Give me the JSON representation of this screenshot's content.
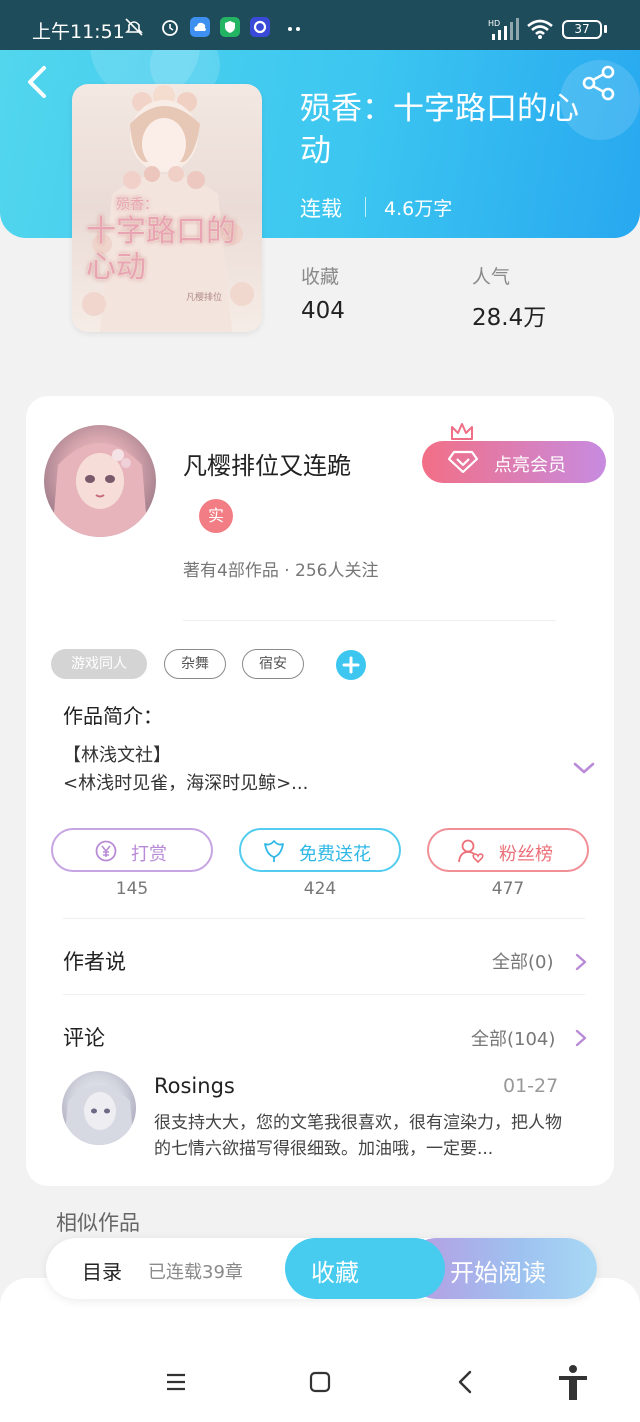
{
  "status_bar": {
    "time": "上午11:51",
    "battery": "37"
  },
  "book": {
    "title": "殒香：十字路口的心动",
    "status": "连载",
    "word_count": "4.6万字",
    "cover_text_top": "殒香：",
    "cover_text_main": "十字路口的心动",
    "cover_text_sub": "凡樱排位"
  },
  "stats": {
    "collect_label": "收藏",
    "collect_value": "404",
    "popularity_label": "人气",
    "popularity_value": "28.4万"
  },
  "author": {
    "name": "凡樱排位又连跪",
    "badge": "实",
    "meta": "著有4部作品 · 256人关注",
    "vip_label": "点亮会员"
  },
  "tags": [
    "游戏同人",
    "杂舞",
    "宿安"
  ],
  "intro": {
    "title": "作品简介：",
    "line1": "【林浅文社】",
    "line2": "<林浅时见雀，海深时见鲸>..."
  },
  "actions": [
    {
      "label": "打赏",
      "count": "145"
    },
    {
      "label": "免费送花",
      "count": "424"
    },
    {
      "label": "粉丝榜",
      "count": "477"
    }
  ],
  "author_says": {
    "title": "作者说",
    "more": "全部(0)"
  },
  "comments": {
    "title": "评论",
    "more": "全部(104)",
    "items": [
      {
        "user": "Rosings",
        "date": "01-27",
        "text": "很支持大大，您的文笔我很喜欢，很有渲染力，把人物的七情六欲描写得很细致。加油哦，一定要..."
      }
    ]
  },
  "similar": {
    "title": "相似作品"
  },
  "bottom_bar": {
    "toc": "目录",
    "chapters": "已连载39章",
    "collect": "收藏",
    "read": "开始阅读"
  },
  "colors": {
    "brand": "#3cc6f0",
    "vip_start": "#f26f86",
    "vip_end": "#c78be0",
    "tip": "#b98bd6",
    "flower": "#3cc6f0",
    "fans": "#f07e86"
  }
}
